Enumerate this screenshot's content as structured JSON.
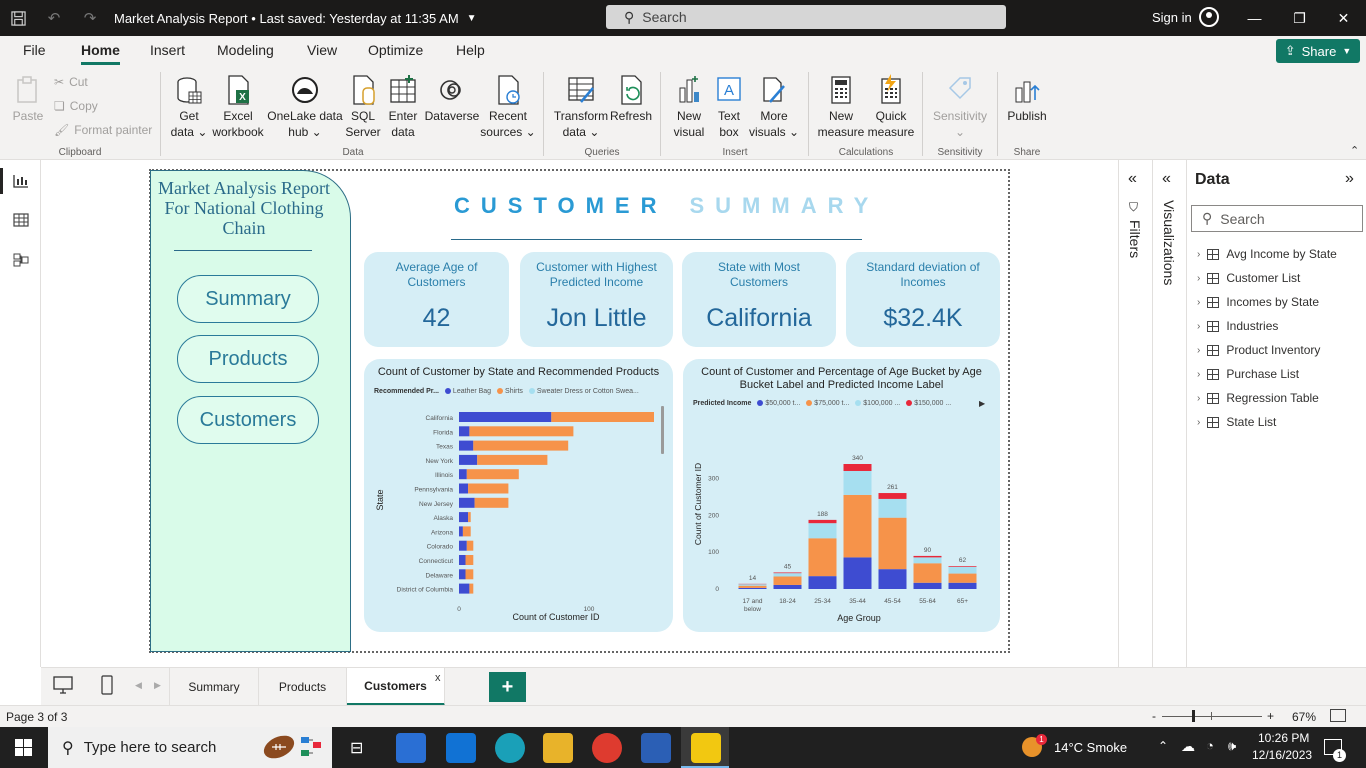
{
  "titlebar": {
    "doc_title": "Market Analysis Report • Last saved: Yesterday at 11:35 AM",
    "search_placeholder": "Search",
    "sign_in": "Sign in"
  },
  "menu": {
    "items": [
      "File",
      "Home",
      "Insert",
      "Modeling",
      "View",
      "Optimize",
      "Help"
    ],
    "active": "Home",
    "share_label": "Share"
  },
  "ribbon": {
    "clipboard": {
      "paste": "Paste",
      "cut": "Cut",
      "copy": "Copy",
      "format_painter": "Format painter",
      "group": "Clipboard"
    },
    "data": {
      "get_data": [
        "Get",
        "data"
      ],
      "excel": [
        "Excel",
        "workbook"
      ],
      "onelake": [
        "OneLake data",
        "hub"
      ],
      "sql": [
        "SQL",
        "Server"
      ],
      "enter": [
        "Enter",
        "data"
      ],
      "dataverse": [
        "Dataverse",
        ""
      ],
      "recent": [
        "Recent",
        "sources"
      ],
      "group": "Data"
    },
    "queries": {
      "transform": [
        "Transform",
        "data"
      ],
      "refresh": [
        "Refresh",
        ""
      ],
      "group": "Queries"
    },
    "insert": {
      "new_visual": [
        "New",
        "visual"
      ],
      "text_box": [
        "Text",
        "box"
      ],
      "more_visuals": [
        "More",
        "visuals"
      ],
      "group": "Insert"
    },
    "calculations": {
      "new_measure": [
        "New",
        "measure"
      ],
      "quick_measure": [
        "Quick",
        "measure"
      ],
      "group": "Calculations"
    },
    "sensitivity": {
      "label": [
        "Sensitivity",
        ""
      ],
      "group": "Sensitivity"
    },
    "share": {
      "publish": [
        "Publish",
        ""
      ],
      "group": "Share"
    }
  },
  "report": {
    "side_title": "Market Analysis Report For National Clothing Chain",
    "nav_buttons": [
      "Summary",
      "Products",
      "Customers"
    ],
    "heading_part1": "CUSTOMER",
    "heading_part2": "SUMMARY",
    "kpis": [
      {
        "label": "Average Age of Customers",
        "value": "42"
      },
      {
        "label": "Customer with Highest Predicted Income",
        "value": "Jon Little"
      },
      {
        "label": "State with Most Customers",
        "value": "California"
      },
      {
        "label": "Standard deviation of Incomes",
        "value": "$32.4K"
      }
    ]
  },
  "chart_data": [
    {
      "type": "bar",
      "orientation": "horizontal",
      "stacked": true,
      "title": "Count of Customer by State and Recommended Products",
      "legend_title": "Recommended Pr...",
      "legend": [
        "Leather Bag",
        "Shirts",
        "Sweater Dress or Cotton Swea..."
      ],
      "colors": [
        "#3e4cd1",
        "#f6934a",
        "#a6dff0"
      ],
      "xlabel": "Count of Customer ID",
      "ylabel": "State",
      "xticks": [
        "0",
        "100"
      ],
      "xlim": [
        0,
        150
      ],
      "categories": [
        "California",
        "Florida",
        "Texas",
        "New York",
        "Illinois",
        "Pennsylvania",
        "New Jersey",
        "Alaska",
        "Arizona",
        "Colorado",
        "Connecticut",
        "Delaware",
        "District of Columbia"
      ],
      "series": [
        {
          "name": "Leather Bag",
          "values": [
            71,
            8,
            11,
            14,
            6,
            7,
            12,
            7,
            3,
            6,
            5,
            5,
            8
          ]
        },
        {
          "name": "Shirts",
          "values": [
            79,
            80,
            73,
            54,
            40,
            31,
            26,
            2,
            6,
            5,
            6,
            6,
            3
          ]
        },
        {
          "name": "Sweater Dress or Cotton Swea...",
          "values": [
            0,
            0,
            0,
            0,
            0,
            0,
            0,
            0,
            0,
            0,
            0,
            0,
            0
          ]
        }
      ]
    },
    {
      "type": "bar",
      "stacked": true,
      "title": "Count of Customer and Percentage of Age Bucket by Age Bucket Label and Predicted Income Label",
      "legend_title": "Predicted Income",
      "legend": [
        "$50,000 t...",
        "$75,000 t...",
        "$100,000 ...",
        "$150,000 ..."
      ],
      "colors": [
        "#3e4cd1",
        "#f6934a",
        "#a6dff0",
        "#e8283a"
      ],
      "xlabel": "Age Group",
      "ylabel": "Count of Customer ID",
      "yticks": [
        "0",
        "100",
        "200",
        "300"
      ],
      "ylim": [
        0,
        340
      ],
      "categories": [
        "17 and below",
        "18-24",
        "25-34",
        "35-44",
        "45-54",
        "55-64",
        "65+"
      ],
      "totals": [
        "14",
        "45",
        "188",
        "340",
        "261",
        "90",
        "62"
      ],
      "series": [
        {
          "name": "$50,000 t...",
          "values": [
            3,
            11,
            35,
            86,
            54,
            17,
            17
          ]
        },
        {
          "name": "$75,000 t...",
          "values": [
            6,
            23,
            103,
            170,
            140,
            53,
            25
          ]
        },
        {
          "name": "$100,000 ...",
          "values": [
            4,
            9,
            41,
            65,
            51,
            16,
            18
          ]
        },
        {
          "name": "$150,000 ...",
          "values": [
            1,
            2,
            9,
            19,
            16,
            4,
            2
          ]
        }
      ]
    }
  ],
  "panes": {
    "filters_label": "Filters",
    "visualizations_label": "Visualizations",
    "data_title": "Data",
    "data_search_placeholder": "Search",
    "data_tables": [
      "Avg Income by State",
      "Customer List",
      "Incomes by State",
      "Industries",
      "Product Inventory",
      "Purchase List",
      "Regression Table",
      "State List"
    ]
  },
  "page_tabs": {
    "tabs": [
      "Summary",
      "Products",
      "Customers"
    ],
    "active": "Customers",
    "close": "x",
    "add": "+"
  },
  "statusbar": {
    "page_info": "Page 3 of 3",
    "zoom_minus": "-",
    "zoom_plus": "+",
    "zoom": "67%"
  },
  "taskbar": {
    "search_placeholder": "Type here to search",
    "weather_badge": "1",
    "weather": "14°C  Smoke",
    "time": "10:26 PM",
    "date": "12/16/2023",
    "notification_count": "1"
  }
}
